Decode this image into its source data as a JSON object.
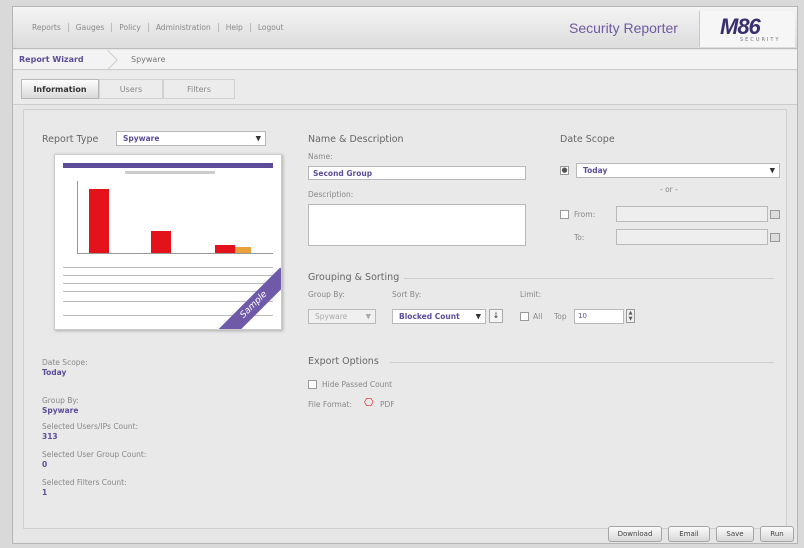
{
  "topnav": [
    "Reports",
    "Gauges",
    "Policy",
    "Administration",
    "Help",
    "Logout"
  ],
  "app_title": "Security Reporter",
  "logo": {
    "main": "M86",
    "sub": "SECURITY"
  },
  "breadcrumb": {
    "root": "Report Wizard",
    "current": "Spyware"
  },
  "steps": [
    "Information",
    "Users",
    "Filters"
  ],
  "report_type": {
    "label": "Report Type",
    "value": "Spyware"
  },
  "preview": {
    "ribbon": "Sample",
    "bars": [
      1.0,
      0.35,
      0.13
    ]
  },
  "summary": {
    "date_scope_label": "Date Scope:",
    "date_scope_value": "Today",
    "group_by_label": "Group By:",
    "group_by_value": "Spyware",
    "users_count_label": "Selected Users/IPs Count:",
    "users_count_value": "313",
    "group_count_label": "Selected User Group Count:",
    "group_count_value": "0",
    "filters_count_label": "Selected Filters Count:",
    "filters_count_value": "1"
  },
  "name_desc": {
    "title": "Name & Description",
    "name_label": "Name:",
    "name_value": "Second Group",
    "desc_label": "Description:"
  },
  "date_scope": {
    "title": "Date Scope",
    "value": "Today",
    "or": "- or -",
    "from_label": "From:",
    "to_label": "To:"
  },
  "grouping": {
    "title": "Grouping & Sorting",
    "group_by_label": "Group By:",
    "group_by_value": "Spyware",
    "sort_by_label": "Sort By:",
    "sort_by_value": "Blocked Count",
    "limit_label": "Limit:",
    "all_label": "All",
    "top_label": "Top",
    "top_value": "10"
  },
  "export": {
    "title": "Export Options",
    "hide_passed": "Hide Passed Count",
    "format_label": "File Format:",
    "format_value": "PDF"
  },
  "buttons": [
    "Download",
    "Email",
    "Save",
    "Run"
  ]
}
